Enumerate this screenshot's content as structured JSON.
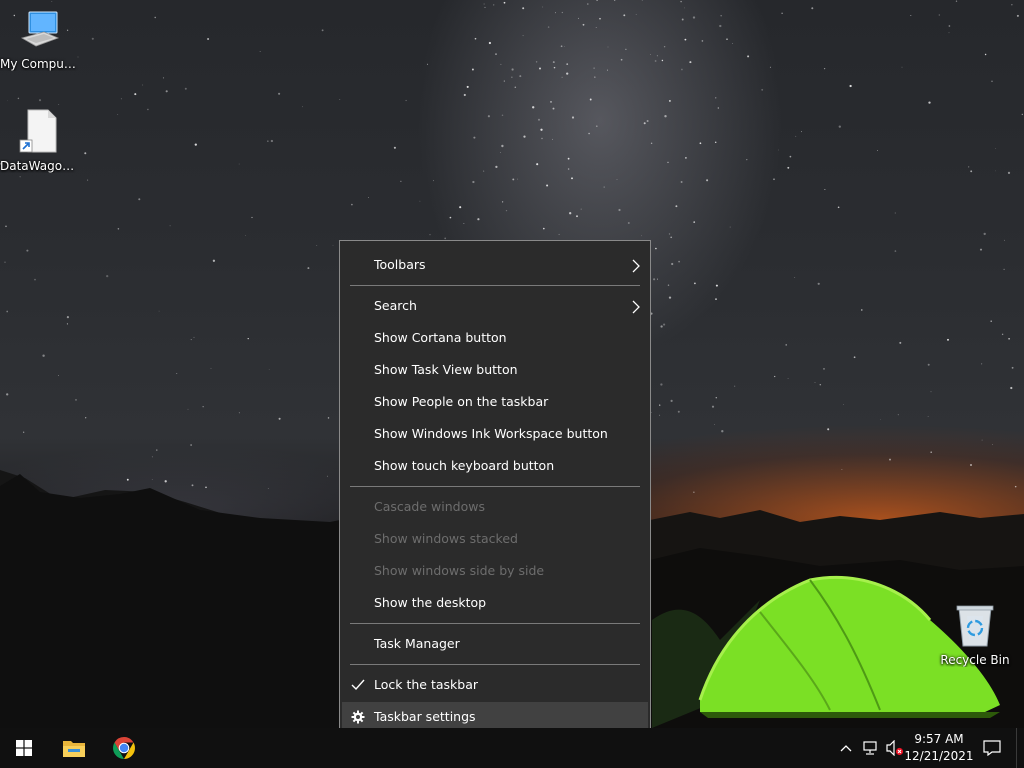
{
  "desktop": {
    "icons": [
      {
        "label": "My Computer",
        "icon": "computer-icon"
      },
      {
        "label": "DataWagon...",
        "icon": "document-shortcut-icon"
      },
      {
        "label": "Recycle Bin",
        "icon": "recycle-bin-icon"
      }
    ]
  },
  "context_menu": {
    "items": [
      {
        "label": "Toolbars",
        "submenu": true,
        "enabled": true
      },
      {
        "label": "Search",
        "submenu": true,
        "enabled": true
      },
      {
        "label": "Show Cortana button",
        "enabled": true
      },
      {
        "label": "Show Task View button",
        "enabled": true
      },
      {
        "label": "Show People on the taskbar",
        "enabled": true
      },
      {
        "label": "Show Windows Ink Workspace button",
        "enabled": true
      },
      {
        "label": "Show touch keyboard button",
        "enabled": true
      },
      {
        "label": "Cascade windows",
        "enabled": false
      },
      {
        "label": "Show windows stacked",
        "enabled": false
      },
      {
        "label": "Show windows side by side",
        "enabled": false
      },
      {
        "label": "Show the desktop",
        "enabled": true
      },
      {
        "label": "Task Manager",
        "enabled": true
      },
      {
        "label": "Lock the taskbar",
        "enabled": true,
        "checked": true
      },
      {
        "label": "Taskbar settings",
        "enabled": true,
        "icon": "gear-icon",
        "highlighted": true
      }
    ]
  },
  "taskbar": {
    "pinned": [
      {
        "name": "Start",
        "icon": "windows-logo-icon"
      },
      {
        "name": "File Explorer",
        "icon": "folder-icon"
      },
      {
        "name": "Google Chrome",
        "icon": "chrome-icon"
      }
    ],
    "tray": {
      "icons": [
        "chevron-up-icon",
        "network-icon",
        "speaker-muted-icon"
      ],
      "time": "9:57 AM",
      "date": "12/21/2021",
      "notification_icon": "action-center-icon"
    }
  },
  "colors": {
    "menu_bg": "#2b2b2b",
    "menu_hover": "#414141",
    "menu_disabled_text": "#6d6d6d",
    "taskbar_bg": "#101010",
    "tent_green": "#7be025"
  }
}
